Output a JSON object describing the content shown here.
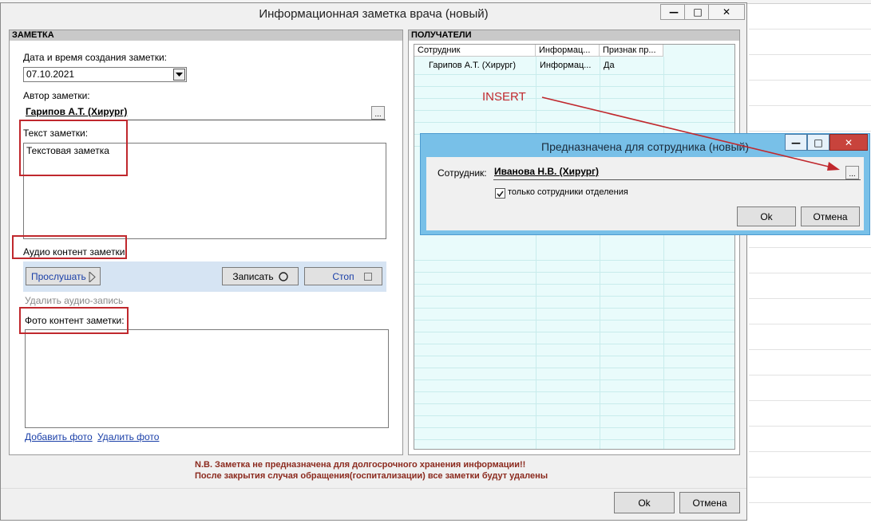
{
  "main_window": {
    "title": "Информационная заметка врача (новый)",
    "controls": {
      "minimize": "—",
      "maximize": "□",
      "close": "✕"
    }
  },
  "note_panel": {
    "header": "ЗАМЕТКА",
    "date_label": "Дата и время создания заметки:",
    "date_value": "07.10.2021",
    "author_label": "Автор заметки:",
    "author_value": "Гарипов А.Т. (Хирург)",
    "author_button": "...",
    "text_label": "Текст заметки:",
    "text_value": "Текстовая заметка",
    "audio_label": "Аудио контент заметки:",
    "play_button": "Прослушать",
    "record_button": "Записать",
    "stop_button": "Стоп",
    "delete_audio": "Удалить аудио-запись",
    "photo_label": "Фото контент заметки:",
    "add_photo": "Добавить фото",
    "delete_photo": "Удалить фото"
  },
  "recipients_panel": {
    "header": "ПОЛУЧАТЕЛИ",
    "columns": [
      "Сотрудник",
      "Информац...",
      "Признак пр..."
    ],
    "rows": [
      [
        "Гарипов А.Т. (Хирург)",
        "Информац...",
        "Да"
      ]
    ]
  },
  "annotation": {
    "label": "INSERT",
    "color": "#c0282d"
  },
  "footer": {
    "note_line1": "N.B. Заметка не предназначена для долгосрочного хранения информации!!",
    "note_line2": "После закрытия случая обращения(госпитализации) все заметки будут удалены",
    "ok": "Ok",
    "cancel": "Отмена"
  },
  "dialog": {
    "title": "Предназначена для сотрудника (новый)",
    "employee_label": "Сотрудник:",
    "employee_value": "Иванова Н.В. (Хирург)",
    "employee_button": "...",
    "only_department": "только сотрудники отделения",
    "only_department_checked": true,
    "ok": "Ok",
    "cancel": "Отмена",
    "controls": {
      "minimize": "—",
      "maximize": "□",
      "close": "✕"
    }
  },
  "colors": {
    "accent_red": "#c0282d",
    "dialog_frame": "#78c0e8",
    "close_button": "#c8433c",
    "grid_bg": "#e9fbfb",
    "note_text": "#8b2a1e",
    "link": "#1a3fa8"
  }
}
